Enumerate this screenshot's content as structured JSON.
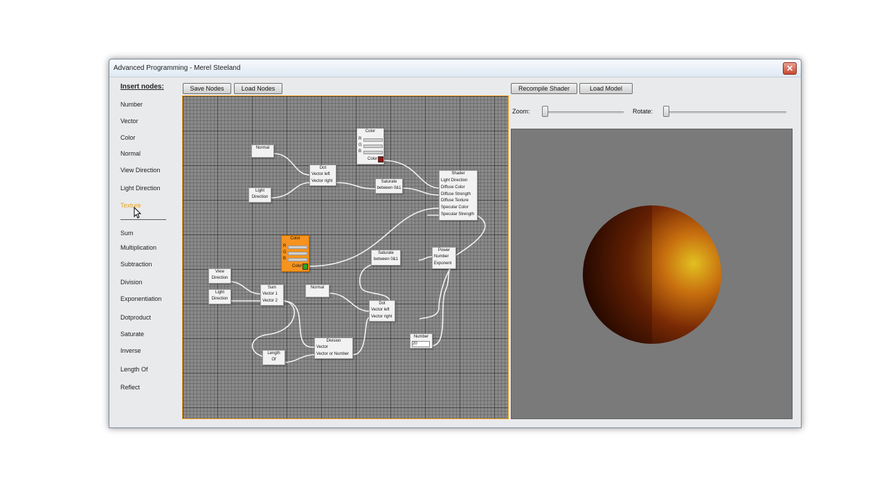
{
  "window": {
    "title": "Advanced Programming - Merel Steeland",
    "close_glyph": "✕"
  },
  "sidebar": {
    "heading": "Insert nodes:",
    "items": [
      {
        "label": "Number"
      },
      {
        "label": "Vector"
      },
      {
        "label": "Color"
      },
      {
        "label": "Normal"
      },
      {
        "label": "View Direction"
      },
      {
        "label": "Light Direction"
      },
      {
        "label": "Texture"
      },
      {
        "label": "Sum"
      },
      {
        "label": "Multiplication"
      },
      {
        "label": "Subtraction"
      },
      {
        "label": "Division"
      },
      {
        "label": "Exponentiation"
      },
      {
        "label": "Dotproduct"
      },
      {
        "label": "Saturate"
      },
      {
        "label": "Inverse"
      },
      {
        "label": "Length Of"
      },
      {
        "label": "Reflect"
      }
    ]
  },
  "toolbar": {
    "save_nodes": "Save Nodes",
    "load_nodes": "Load Nodes",
    "recompile_shader": "Recompile Shader",
    "load_model": "Load Model"
  },
  "controls": {
    "zoom_label": "Zoom:",
    "rotate_label": "Rotate:",
    "zoom_value": 0.0,
    "rotate_value": 0.0
  },
  "nodes": {
    "normal1": {
      "title": "Normal"
    },
    "light1": {
      "title": "Light",
      "title2": "Direction"
    },
    "dot1": {
      "title": "Dot",
      "in1": "Vector left",
      "in2": "Vector right"
    },
    "color_top": {
      "title": "Color",
      "r": "R",
      "g": "G",
      "b": "B",
      "out": "Color",
      "swatch": "#9a1010"
    },
    "saturate1": {
      "title": "Saturate",
      "title2": "between 0&1"
    },
    "shader": {
      "title": "Shader",
      "p1": "Light Direction",
      "p2": "Diffuse Color",
      "p3": "Diffuse Strength",
      "p4": "Diffuse Texture",
      "p5": "Specular Color",
      "p6": "Specular Strength"
    },
    "color_orange": {
      "title": "Color",
      "r": "R",
      "g": "G",
      "b": "B",
      "out": "Color",
      "swatch": "#2aa52a"
    },
    "saturate2": {
      "title": "Saturate",
      "title2": "between 0&1"
    },
    "power": {
      "title": "Power",
      "p1": "Number",
      "p2": "Exponent"
    },
    "view": {
      "title": "View",
      "title2": "Direction"
    },
    "light2": {
      "title": "Light",
      "title2": "Direction"
    },
    "sum": {
      "title": "Sum",
      "p1": "Vector 1",
      "p2": "Vector 2"
    },
    "normal2": {
      "title": "Normal"
    },
    "dot2": {
      "title": "Dot",
      "in1": "Vector left",
      "in2": "Vector right"
    },
    "number": {
      "title": "Number",
      "value": "20"
    },
    "length": {
      "title": "Length",
      "title2": "Of"
    },
    "division": {
      "title": "Division",
      "p1": "Vector",
      "p2": "Vector or Number"
    }
  },
  "colors": {
    "accent": "#f6a21c",
    "sphere_light": "#e2c021",
    "sphere_dark": "#1a0600",
    "orange_node": "#f5931e"
  },
  "icons": {
    "close": "close-icon",
    "cursor": "mouse-cursor-icon"
  }
}
